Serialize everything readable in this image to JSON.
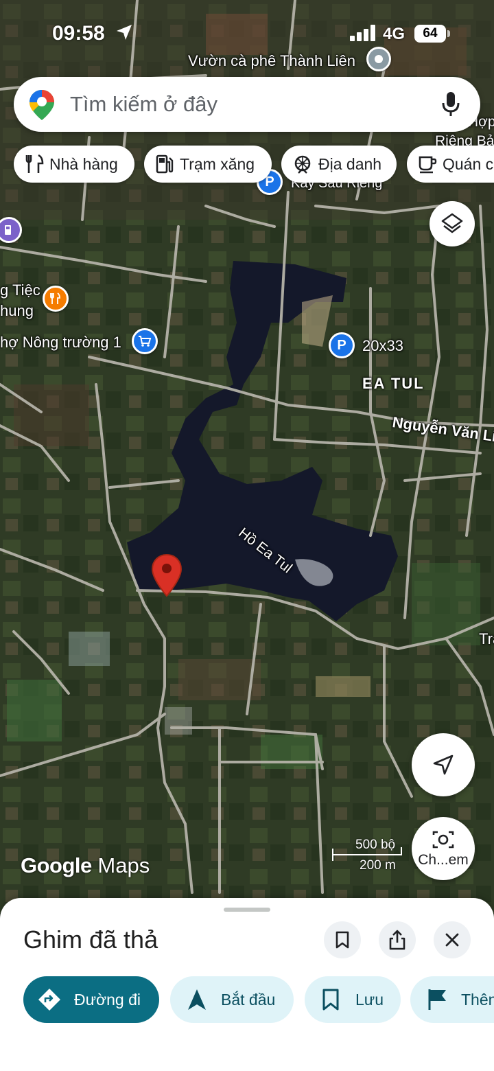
{
  "status_bar": {
    "time": "09:58",
    "network": "4G",
    "battery": "64"
  },
  "search": {
    "placeholder": "Tìm kiếm ở đây"
  },
  "chips": [
    {
      "label": "Nhà hàng",
      "icon": "restaurant-icon"
    },
    {
      "label": "Trạm xăng",
      "icon": "gas-station-icon"
    },
    {
      "label": "Địa danh",
      "icon": "landmark-icon"
    },
    {
      "label": "Quán c",
      "icon": "coffee-icon"
    }
  ],
  "map": {
    "labels": {
      "vuon_ca_phe": "Vườn cà phê Thành Liên",
      "top_right_1": "Hợp",
      "top_right_2": "Riêng Bả",
      "kay_sau_rieng": "Kay Sầu Riêng",
      "tiec": "g Tiệc",
      "hung": "hung",
      "cho_nong_truong": "hợ Nông trường 1",
      "parking_20x33": "20x33",
      "ea_tul": "EA TUL",
      "nguyen_van_linh": "Nguyễn Văn Lin",
      "lake": "Hồ Ea Tul",
      "right_edge": "Tra"
    },
    "scale": {
      "top": "500 bộ",
      "bottom": "200 m"
    },
    "brand": {
      "google": "Google",
      "maps": "Maps"
    },
    "explore_label": "Ch...em"
  },
  "sheet": {
    "title": "Ghim đã thả",
    "actions": [
      {
        "label": "Đường đi",
        "icon": "directions-icon"
      },
      {
        "label": "Bắt đầu",
        "icon": "navigation-arrow-icon"
      },
      {
        "label": "Lưu",
        "icon": "bookmark-icon"
      },
      {
        "label": "Thên",
        "icon": "flag-icon"
      }
    ]
  },
  "colors": {
    "primary_teal": "#0b6e83",
    "chip_light": "#dff3f8",
    "pin_red": "#d93025",
    "poi_blue": "#1a73e8",
    "poi_orange": "#f57c00"
  }
}
